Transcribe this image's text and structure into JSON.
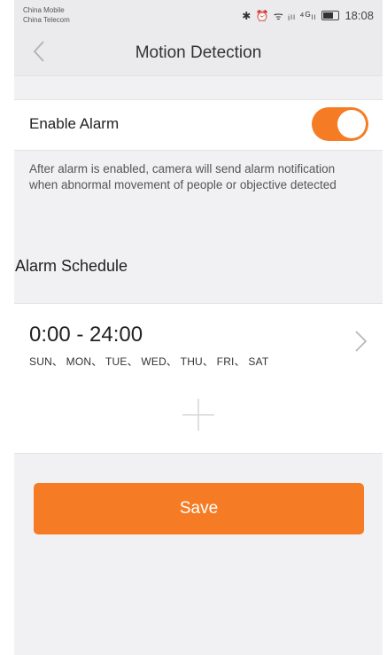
{
  "status_bar": {
    "carrier_1": "China Mobile",
    "carrier_2": "China Telecom",
    "icons": "✱ ⏰ ᯤ ᵢₗₗ ⁴ᴳₗₗ",
    "time": "18:08"
  },
  "nav": {
    "title": "Motion Detection",
    "back_icon": "chevron-left-icon"
  },
  "alarm": {
    "label": "Enable Alarm",
    "enabled": true,
    "description": "After alarm is enabled, camera will send alarm notification when abnormal movement of people or objective detected"
  },
  "schedule": {
    "section_title": "Alarm Schedule",
    "items": [
      {
        "time_range": "0:00 - 24:00",
        "days": "SUN、 MON、 TUE、 WED、 THU、 FRI、 SAT"
      }
    ],
    "add_icon": "plus-icon"
  },
  "actions": {
    "save_label": "Save"
  },
  "colors": {
    "accent": "#f57c24",
    "background": "#f1f1f3"
  }
}
